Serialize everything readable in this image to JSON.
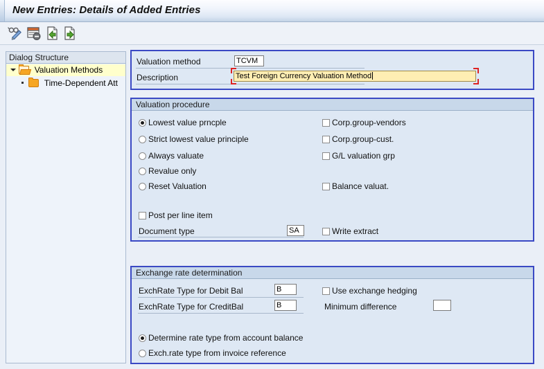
{
  "window": {
    "title": "New Entries: Details of Added Entries"
  },
  "toolbar": {
    "buttons": [
      {
        "name": "display-change-icon",
        "title": "Display/Change"
      },
      {
        "name": "delete-entry-icon",
        "title": "Delete"
      },
      {
        "name": "previous-entry-icon",
        "title": "Previous Entry"
      },
      {
        "name": "next-entry-icon",
        "title": "Next Entry"
      }
    ]
  },
  "tree": {
    "header": "Dialog Structure",
    "items": [
      {
        "label": "Valuation Methods",
        "selected": true,
        "icon": "folder-open-icon"
      },
      {
        "label": "Time-Dependent Att",
        "selected": false,
        "icon": "folder-closed-icon"
      }
    ]
  },
  "header_panel": {
    "valuation_method_label": "Valuation method",
    "valuation_method_value": "TCVM",
    "description_label": "Description",
    "description_value": "Test Foreign Currency Valuation Method"
  },
  "valuation_procedure": {
    "title": "Valuation procedure",
    "radios": [
      {
        "label": "Lowest value prncple",
        "selected": true
      },
      {
        "label": "Strict lowest value principle",
        "selected": false
      },
      {
        "label": "Always valuate",
        "selected": false
      },
      {
        "label": "Revalue only",
        "selected": false
      },
      {
        "label": "Reset Valuation",
        "selected": false
      }
    ],
    "checkboxes_right": [
      {
        "label": "Corp.group-vendors",
        "checked": false
      },
      {
        "label": "Corp.group-cust.",
        "checked": false
      },
      {
        "label": "G/L valuation grp",
        "checked": false
      },
      {
        "label": "Balance valuat.",
        "checked": false
      }
    ],
    "post_per_line_item_label": "Post per line item",
    "post_per_line_item_checked": false,
    "document_type_label": "Document type",
    "document_type_value": "SA",
    "write_extract_label": "Write extract",
    "write_extract_checked": false
  },
  "exchange_rate": {
    "title": "Exchange rate determination",
    "debit_label": "ExchRate Type for Debit Bal",
    "debit_value": "B",
    "credit_label": "ExchRate Type for CreditBal",
    "credit_value": "B",
    "hedging_label": "Use exchange hedging",
    "hedging_checked": false,
    "min_diff_label": "Minimum difference",
    "min_diff_value": "",
    "radios": [
      {
        "label": "Determine rate type from account balance",
        "selected": true
      },
      {
        "label": "Exch.rate type from invoice reference",
        "selected": false
      }
    ]
  },
  "colors": {
    "groupbox_border": "#3a49c4",
    "groupbox_body": "#dee8f4",
    "groupbox_header": "#c8d8ea",
    "page_background": "#eaeff7",
    "focused_field": "#ffeeb3",
    "focus_bracket": "#d22222",
    "tree_selection": "#ffffcc"
  }
}
